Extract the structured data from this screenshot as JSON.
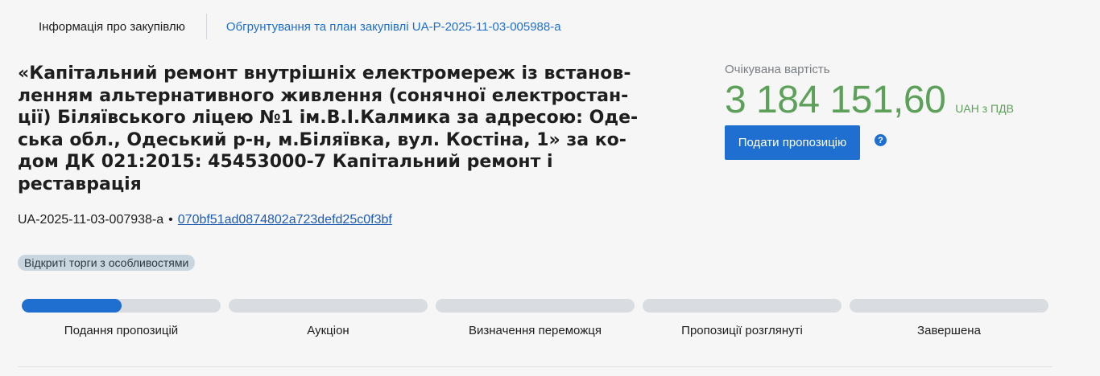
{
  "tabs": {
    "active": "Інформація про закупівлю",
    "link": "Обгрунтування та план закупівлі UA-P-2025-11-03-005988-a"
  },
  "tender": {
    "title": "«Капітальний ремонт внутрішніх електромереж із встанов-\nленням альтернативного живлення (сонячної електростан-\nції) Біляївського ліцею №1 ім.В.І.Калмика за адресою: Оде-\nська обл., Одеський р-н, м.Біляївка, вул. Костіна, 1» за ко-\nдом ДК 021:2015: 45453000-7 Капітальний ремонт і\nреставрація",
    "id": "UA-2025-11-03-007938-a",
    "separator": "•",
    "hash": "070bf51ad0874802a723defd25c0f3bf",
    "procedure_badge": "Відкриті торги з особливостями"
  },
  "value": {
    "label": "Очікувана вартість",
    "amount": "3 184 151,60",
    "currency": "UAH з ПДВ"
  },
  "actions": {
    "submit_label": "Подати пропозицію",
    "help_symbol": "?"
  },
  "progress": {
    "stages": [
      {
        "label": "Подання пропозицій",
        "progress": 0.5
      },
      {
        "label": "Аукціон",
        "progress": 0
      },
      {
        "label": "Визначення переможця",
        "progress": 0
      },
      {
        "label": "Пропозиції розглянуті",
        "progress": 0
      },
      {
        "label": "Завершена",
        "progress": 0
      }
    ]
  },
  "colors": {
    "accent": "#1e6fd0",
    "value_green": "#5da05a",
    "badge_bg": "#c9d6df"
  }
}
